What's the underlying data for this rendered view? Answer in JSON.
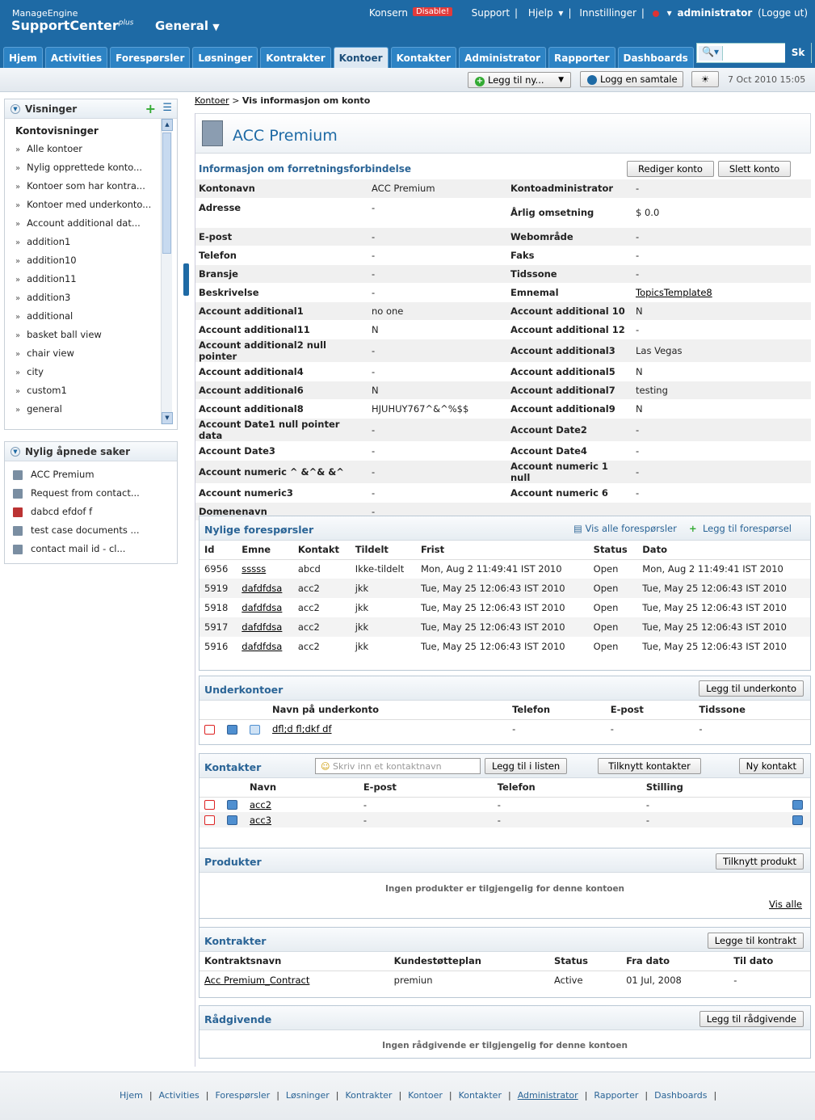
{
  "header": {
    "logo_small": "ManageEngine",
    "logo_big": "SupportCenter",
    "logo_sup": "plus",
    "portal": "General",
    "konsern": "Konsern",
    "disable": "Disable!",
    "support": "Support",
    "help": "Hjelp",
    "settings": "Innstillinger",
    "user": "administrator",
    "logout": "(Logge ut)",
    "search_button": "Sk"
  },
  "tabs": [
    "Hjem",
    "Activities",
    "Forespørsler",
    "Løsninger",
    "Kontrakter",
    "Kontoer",
    "Kontakter",
    "Administrator",
    "Rapporter",
    "Dashboards"
  ],
  "active_tab": "Kontoer",
  "toolbar": {
    "add_new": "Legg til ny...",
    "log_chat": "Logg en samtale",
    "datetime": "7 Oct 2010 15:05"
  },
  "sidebar": {
    "views_title": "Visninger",
    "views_heading": "Kontovisninger",
    "views": [
      "Alle kontoer",
      "Nylig opprettede konto...",
      "Kontoer som har kontra...",
      "Kontoer med underkonto...",
      "Account additional dat...",
      "addition1",
      "addition10",
      "addition11",
      "addition3",
      "additional",
      "basket ball view",
      "chair view",
      "city",
      "custom1",
      "general"
    ],
    "recent_title": "Nylig åpnede saker",
    "recent": [
      "ACC Premium",
      "Request from contact...",
      "dabcd efdof f",
      "test case documents ...",
      "contact mail id - cl..."
    ]
  },
  "breadcrumb": {
    "link": "Kontoer",
    "current": "Vis informasjon om konto"
  },
  "account": {
    "name": "ACC Premium",
    "info_heading": "Informasjon om forretningsforbindelse",
    "edit_button": "Rediger konto",
    "delete_button": "Slett konto",
    "fields": [
      [
        "Kontonavn",
        "ACC Premium",
        "Kontoadministrator",
        "-"
      ],
      [
        "Adresse",
        "-",
        "Årlig omsetning",
        "$ 0.0"
      ],
      [
        "E-post",
        "-",
        "Webområde",
        "-"
      ],
      [
        "Telefon",
        "-",
        "Faks",
        "-"
      ],
      [
        "Bransje",
        "-",
        "Tidssone",
        "-"
      ],
      [
        "Beskrivelse",
        "-",
        "Emnemal",
        "TopicsTemplate8"
      ],
      [
        "Account additional1",
        "no one",
        "Account additional 10",
        "N"
      ],
      [
        "Account additional11",
        "N",
        "Account additional 12",
        "-"
      ],
      [
        "Account additional2 null pointer",
        "-",
        "Account additional3",
        "Las Vegas"
      ],
      [
        "Account additional4",
        "-",
        "Account additional5",
        "N"
      ],
      [
        "Account additional6",
        "N",
        "Account additional7",
        "testing"
      ],
      [
        "Account additional8",
        "HJUHUY767^&^%$$",
        "Account additional9",
        "N"
      ],
      [
        "Account Date1 null pointer data",
        "-",
        "Account Date2",
        "-"
      ],
      [
        "Account Date3",
        "-",
        "Account Date4",
        "-"
      ],
      [
        "Account numeric ^ &^& &^",
        "-",
        "Account numeric 1 null",
        "-"
      ],
      [
        "Account numeric3",
        "-",
        "Account numeric 6",
        "-"
      ],
      [
        "Domenenavn",
        "-",
        "",
        ""
      ]
    ]
  },
  "requests": {
    "title": "Nylige forespørsler",
    "view_all": "Vis alle forespørsler",
    "add": "Legg til forespørsel",
    "columns": [
      "Id",
      "Emne",
      "Kontakt",
      "Tildelt",
      "Frist",
      "Status",
      "Dato"
    ],
    "rows": [
      [
        "6956",
        "sssss",
        "abcd",
        "Ikke-tildelt",
        "Mon, Aug 2 11:49:41 IST 2010",
        "Open",
        "Mon, Aug 2 11:49:41 IST 2010"
      ],
      [
        "5919",
        "dafdfdsa",
        "acc2",
        "jkk",
        "Tue, May 25 12:06:43 IST 2010",
        "Open",
        "Tue, May 25 12:06:43 IST 2010"
      ],
      [
        "5918",
        "dafdfdsa",
        "acc2",
        "jkk",
        "Tue, May 25 12:06:43 IST 2010",
        "Open",
        "Tue, May 25 12:06:43 IST 2010"
      ],
      [
        "5917",
        "dafdfdsa",
        "acc2",
        "jkk",
        "Tue, May 25 12:06:43 IST 2010",
        "Open",
        "Tue, May 25 12:06:43 IST 2010"
      ],
      [
        "5916",
        "dafdfdsa",
        "acc2",
        "jkk",
        "Tue, May 25 12:06:43 IST 2010",
        "Open",
        "Tue, May 25 12:06:43 IST 2010"
      ]
    ]
  },
  "subaccounts": {
    "title": "Underkontoer",
    "add": "Legg til underkonto",
    "columns": [
      "Navn på underkonto",
      "Telefon",
      "E-post",
      "Tidssone"
    ],
    "rows": [
      [
        "dfl;d fl;dkf df",
        "-",
        "-",
        "-"
      ]
    ]
  },
  "contacts": {
    "title": "Kontakter",
    "placeholder": "Skriv inn et kontaktnavn",
    "add_list": "Legg til i listen",
    "assign": "Tilknytt kontakter",
    "new": "Ny kontakt",
    "columns": [
      "Navn",
      "E-post",
      "Telefon",
      "Stilling"
    ],
    "rows": [
      [
        "acc2",
        "-",
        "-",
        "-"
      ],
      [
        "acc3",
        "-",
        "-",
        "-"
      ]
    ]
  },
  "products": {
    "title": "Produkter",
    "assign": "Tilknytt produkt",
    "empty": "Ingen produkter er tilgjengelig for denne kontoen",
    "view_all": "Vis alle"
  },
  "contracts": {
    "title": "Kontrakter",
    "add": "Legge til kontrakt",
    "columns": [
      "Kontraktsnavn",
      "Kundestøtteplan",
      "Status",
      "Fra dato",
      "Til dato"
    ],
    "rows": [
      [
        "Acc Premium_Contract",
        "premiun",
        "Active",
        "01 Jul, 2008",
        "-"
      ]
    ]
  },
  "advisors": {
    "title": "Rådgivende",
    "add": "Legg til rådgivende",
    "empty": "Ingen rådgivende er tilgjengelig for denne kontoen"
  },
  "footer": [
    "Hjem",
    "Activities",
    "Forespørsler",
    "Løsninger",
    "Kontrakter",
    "Kontoer",
    "Kontakter",
    "Administrator",
    "Rapporter",
    "Dashboards"
  ]
}
